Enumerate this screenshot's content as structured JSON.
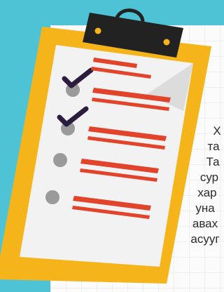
{
  "illustration": {
    "colors": {
      "background": "#4ec3d6",
      "clipboard": "#f6b41b",
      "sheet": "#f2f2f2",
      "clip": "#222222",
      "accent": "#f6b41b",
      "bars": "#e2432b",
      "bullets": "#9a9a9a",
      "checkmarks": "#2b1d3d"
    },
    "checklist": {
      "items": [
        {
          "checked": true
        },
        {
          "checked": true
        },
        {
          "checked": false
        },
        {
          "checked": false
        }
      ]
    }
  },
  "side_text": {
    "lines": [
      "Х",
      "та",
      "Та",
      "сур",
      "хар",
      "уна",
      "авах",
      "асууг"
    ]
  }
}
